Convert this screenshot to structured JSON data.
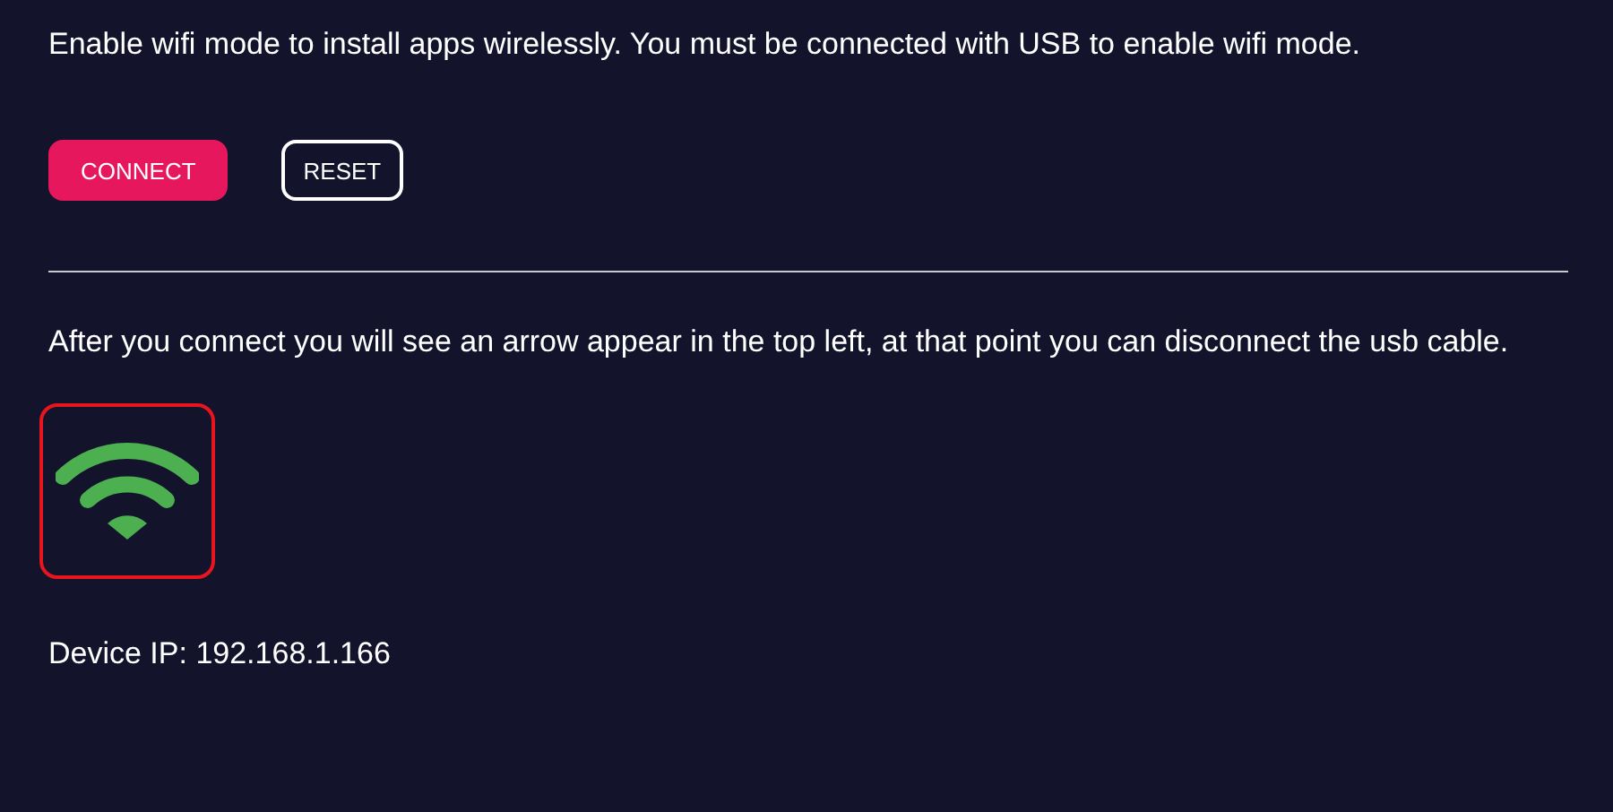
{
  "intro": "Enable wifi mode to install apps wirelessly. You must be connected with USB to enable wifi mode.",
  "buttons": [
    {
      "label": "CONNECT",
      "kind": "primary"
    },
    {
      "label": "RESET",
      "kind": "outline"
    }
  ],
  "instructions": "After you connect you will see an arrow appear in the top left, at that point you can disconnect the usb cable.",
  "device_ip": "Device IP: 192.168.1.166"
}
